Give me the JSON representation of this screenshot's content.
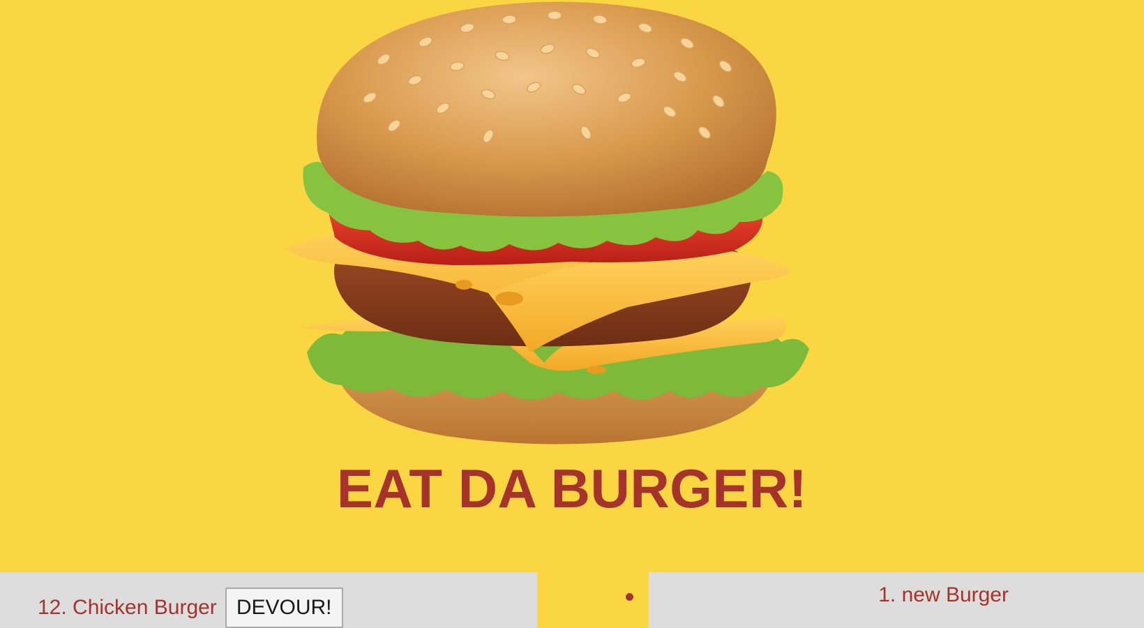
{
  "header": {
    "title": "EAT DA BURGER!"
  },
  "hero": {
    "image_icon": "burger-icon"
  },
  "uneaten": {
    "items": [
      {
        "label": "12. Chicken Burger",
        "button_label": "DEVOUR!"
      }
    ]
  },
  "devoured": {
    "items": [
      {
        "label": "1. new Burger"
      }
    ]
  },
  "colors": {
    "background": "#FAD643",
    "accent": "#A5322B",
    "panel": "#DEDDDD"
  }
}
